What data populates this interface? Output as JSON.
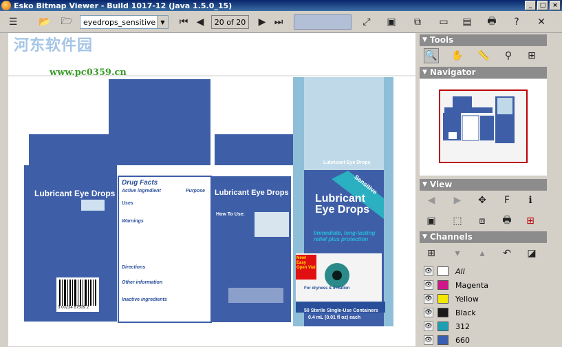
{
  "window": {
    "title": "Esko Bitmap Viewer - Build 1017-12 (Java 1.5.0_15)"
  },
  "toolbar": {
    "file_value": "eyedrops_sensitive",
    "page_indicator": "20 of 20"
  },
  "watermark": {
    "chinese": "河东软件园",
    "url": "www.pc0359.cn"
  },
  "panels": {
    "tools_label": "Tools",
    "navigator_label": "Navigator",
    "view_label": "View",
    "channels_label": "Channels"
  },
  "channels": [
    {
      "name": "All",
      "color": "#ffffff"
    },
    {
      "name": "Magenta",
      "color": "#d0178a"
    },
    {
      "name": "Yellow",
      "color": "#f5e800"
    },
    {
      "name": "Black",
      "color": "#1a1a1a"
    },
    {
      "name": "312",
      "color": "#1ea0b4"
    },
    {
      "name": "660",
      "color": "#3a5fb0"
    }
  ],
  "artwork": {
    "front_title_1": "Lubricant",
    "front_title_2": "Eye Drops",
    "front_banner": "Sensitive",
    "front_subtitle": "Lubricant Eye Drops",
    "front_tag": "Immediate, long-lasting relief plus protection",
    "front_badge_1": "New! Easy Open Vial",
    "front_bottom": "50 Sterile Single-Use Containers",
    "front_bottom_2": "0.4 mL (0.01 fl oz) each",
    "left_title": "Lubricant Eye Drops",
    "right_title": "Lubricant Eye Drops",
    "drug_facts": "Drug Facts",
    "active_ingredient": "Active ingredient",
    "purpose": "Purpose",
    "uses": "Uses",
    "warnings": "Warnings",
    "directions": "Directions",
    "other_info": "Other information",
    "inactive": "Inactive ingredients",
    "barcode": "3 00234 87509 2",
    "how_to_use": "How To Use:",
    "for_dryness": "For dryness & irritation"
  }
}
